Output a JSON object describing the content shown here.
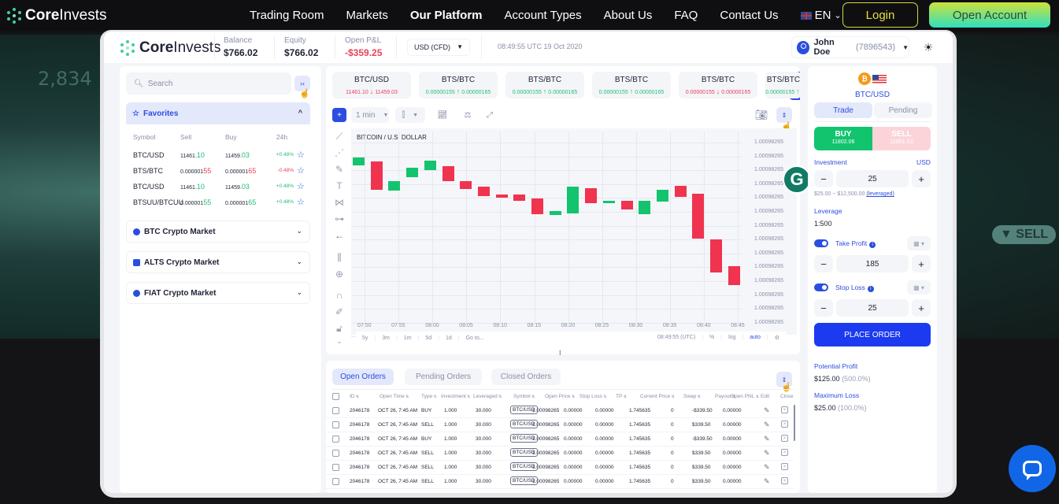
{
  "site": {
    "brand_bold": "Core",
    "brand_light": "Invests",
    "nav": [
      "Trading Room",
      "Markets",
      "Our Platform",
      "Account Types",
      "About Us",
      "FAQ",
      "Contact Us"
    ],
    "nav_active": "Our Platform",
    "language": "EN",
    "login_label": "Login",
    "open_account_label": "Open Account",
    "bg_price": "2,834",
    "bg_sell_badge": "SELL"
  },
  "header": {
    "brand_bold": "Core",
    "brand_light": "Invests",
    "balance_label": "Balance",
    "balance_value": "$766.02",
    "equity_label": "Equity",
    "equity_value": "$766.02",
    "pnl_label": "Open P&L",
    "pnl_value": "-$359.25",
    "currency_select": "USD (CFD)",
    "datetime": "08:49:55 UTC 19 Oct 2020",
    "user_name": "John Doe",
    "user_id": "(7896543)"
  },
  "sidebar": {
    "search_placeholder": "Search",
    "favorites_label": "Favorites",
    "columns": [
      "Symbol",
      "Sell",
      "Buy",
      "24h"
    ],
    "favorites": [
      {
        "symbol": "BTC/USD",
        "sell_main": "11461.",
        "sell_hi": "10",
        "buy_main": "11459.",
        "buy_hi": "03",
        "change": "+0.48%",
        "trend": "up"
      },
      {
        "symbol": "BTS/BTC",
        "sell_main": "0.000001",
        "sell_hi": "55",
        "buy_main": "0.000001",
        "buy_hi": "65",
        "change": "-0.48%",
        "trend": "down"
      },
      {
        "symbol": "BTC/USD",
        "sell_main": "11461.",
        "sell_hi": "10",
        "buy_main": "11459.",
        "buy_hi": "03",
        "change": "+0.48%",
        "trend": "up"
      },
      {
        "symbol": "BTSUU/BTCUU",
        "sell_main": "0.000001",
        "sell_hi": "55",
        "buy_main": "0.000001",
        "buy_hi": "65",
        "change": "+0.48%",
        "trend": "up"
      }
    ],
    "markets": [
      "BTC Crypto Market",
      "ALTS Crypto Market",
      "FIAT Crypto Market"
    ]
  },
  "tickers": [
    {
      "symbol": "BTC/USD",
      "sell": "11461.10",
      "buy": "11459.03",
      "trend": "down"
    },
    {
      "symbol": "BTS/BTC",
      "sell": "0.00000155",
      "buy": "0.00000165",
      "trend": "up"
    },
    {
      "symbol": "BTS/BTC",
      "sell": "0.00000155",
      "buy": "0.00000165",
      "trend": "up"
    },
    {
      "symbol": "BTS/BTC",
      "sell": "0.00000155",
      "buy": "0.00000165",
      "trend": "up"
    },
    {
      "symbol": "BTS/BTC",
      "sell": "0.00000155",
      "buy": "0.00000165",
      "trend": "down"
    },
    {
      "symbol": "BTS/BTC",
      "sell": "0.00000155",
      "buy": "",
      "trend": "up"
    }
  ],
  "chart_toolbar": {
    "interval": "1 min"
  },
  "chart_data": {
    "type": "candlestick",
    "title": "BITCOIN / U.S. DOLLAR",
    "x_ticks": [
      "07:50",
      "07:55",
      "08:00",
      "08:05",
      "08:10",
      "08:15",
      "08:20",
      "08:25",
      "08:30",
      "08:35",
      "08:40",
      "08:45"
    ],
    "y_ticks": [
      "1.00098265",
      "1.00098265",
      "1.00098265",
      "1.00098265",
      "1.00098265",
      "1.00098265",
      "1.00098265",
      "1.00098265",
      "1.00098265",
      "1.00098265",
      "1.00098265",
      "1.00098265",
      "1.00098265",
      "1.00098265",
      "1.00098265"
    ],
    "y_range_relative": [
      0,
      100
    ],
    "candles": [
      {
        "open": 85.5,
        "close": 90.5,
        "dir": "up"
      },
      {
        "open": 88,
        "close": 71,
        "dir": "down"
      },
      {
        "open": 70.5,
        "close": 76,
        "dir": "up"
      },
      {
        "open": 78.5,
        "close": 84,
        "dir": "up"
      },
      {
        "open": 83,
        "close": 88.5,
        "dir": "up"
      },
      {
        "open": 85,
        "close": 76,
        "dir": "down"
      },
      {
        "open": 76,
        "close": 71.5,
        "dir": "down"
      },
      {
        "open": 72.5,
        "close": 67,
        "dir": "down"
      },
      {
        "open": 68,
        "close": 66,
        "dir": "down"
      },
      {
        "open": 68,
        "close": 64,
        "dir": "down"
      },
      {
        "open": 65.5,
        "close": 56,
        "dir": "down"
      },
      {
        "open": 55.5,
        "close": 58,
        "dir": "up"
      },
      {
        "open": 56.5,
        "close": 72.5,
        "dir": "up"
      },
      {
        "open": 72,
        "close": 62.5,
        "dir": "down"
      },
      {
        "open": 62.5,
        "close": 64,
        "dir": "up"
      },
      {
        "open": 64,
        "close": 59,
        "dir": "down"
      },
      {
        "open": 56,
        "close": 64,
        "dir": "up"
      },
      {
        "open": 63.5,
        "close": 71,
        "dir": "up"
      },
      {
        "open": 73,
        "close": 66.5,
        "dir": "down"
      },
      {
        "open": 68.5,
        "close": 41,
        "dir": "down"
      },
      {
        "open": 40.5,
        "close": 20.5,
        "dir": "down"
      },
      {
        "open": 24.5,
        "close": 13,
        "dir": "down"
      }
    ],
    "range_buttons": [
      "5y",
      "3m",
      "1m",
      "5d",
      "1d",
      "Go to..."
    ],
    "clock": "08:49:55 (UTC)",
    "scale_options": [
      "%",
      "log",
      "auto"
    ]
  },
  "orders": {
    "tabs": [
      "Open Orders",
      "Pending Orders",
      "Closed Orders"
    ],
    "active_tab": "Open Orders",
    "columns": [
      "ID",
      "Open Time",
      "Type",
      "Investment",
      "Leveraged",
      "Symbol",
      "Open Price",
      "Stop Loss",
      "TP",
      "Current Price",
      "Swap",
      "Payout",
      "Open PNL",
      "Edit",
      "Close"
    ],
    "rows": [
      {
        "id": "2046178",
        "time": "OCT 26, 7:45 AM",
        "type": "BUY",
        "investment": "1.000",
        "leveraged": "30.000",
        "symbol": "BTC/USD",
        "open_price": "1.00098265",
        "stop_loss": "0.00000",
        "tp": "0.00000",
        "current": "1.745635",
        "swap": "0",
        "payout": "-$339.50",
        "pnl": "0.00000",
        "result": "loss"
      },
      {
        "id": "2046178",
        "time": "OCT 26, 7:45 AM",
        "type": "SELL",
        "investment": "1.000",
        "leveraged": "30.000",
        "symbol": "BTC/USD",
        "open_price": "1.00098265",
        "stop_loss": "0.00000",
        "tp": "0.00000",
        "current": "1.745635",
        "swap": "0",
        "payout": "$339.50",
        "pnl": "0.00000",
        "result": "gain"
      },
      {
        "id": "2046178",
        "time": "OCT 26, 7:45 AM",
        "type": "BUY",
        "investment": "1.000",
        "leveraged": "30.000",
        "symbol": "BTC/USD",
        "open_price": "1.00098265",
        "stop_loss": "0.00000",
        "tp": "0.00000",
        "current": "1.745635",
        "swap": "0",
        "payout": "-$339.50",
        "pnl": "0.00000",
        "result": "loss"
      },
      {
        "id": "2046178",
        "time": "OCT 26, 7:45 AM",
        "type": "SELL",
        "investment": "1.000",
        "leveraged": "30.000",
        "symbol": "BTC/USD",
        "open_price": "1.00098265",
        "stop_loss": "0.00000",
        "tp": "0.00000",
        "current": "1.745635",
        "swap": "0",
        "payout": "$339.50",
        "pnl": "0.00000",
        "result": "gain"
      },
      {
        "id": "2046178",
        "time": "OCT 26, 7:45 AM",
        "type": "SELL",
        "investment": "1.000",
        "leveraged": "30.000",
        "symbol": "BTC/USD",
        "open_price": "1.00098265",
        "stop_loss": "0.00000",
        "tp": "0.00000",
        "current": "1.745635",
        "swap": "0",
        "payout": "$339.50",
        "pnl": "0.00000",
        "result": "gain"
      },
      {
        "id": "2046178",
        "time": "OCT 26, 7:45 AM",
        "type": "SELL",
        "investment": "1.000",
        "leveraged": "30.000",
        "symbol": "BTC/USD",
        "open_price": "1.00098265",
        "stop_loss": "0.00000",
        "tp": "0.00000",
        "current": "1.745635",
        "swap": "0",
        "payout": "$339.50",
        "pnl": "0.00000",
        "result": "gain"
      }
    ]
  },
  "trade": {
    "symbol": "BTC/USD",
    "tabs": [
      "Trade",
      "Pending"
    ],
    "buy_label": "BUY",
    "buy_price": "11802.06",
    "sell_label": "SELL",
    "sell_price": "11801.53",
    "investment_label": "Investment",
    "investment_currency": "USD",
    "investment_value": "25",
    "investment_range": "$25.00 ~ $12,500.00",
    "leveraged_link": "(leveraged)",
    "leverage_label": "Leverage",
    "leverage_value": "1:500",
    "take_profit_label": "Take Profit",
    "take_profit_value": "185",
    "take_profit_enabled": true,
    "stop_loss_label": "Stop Loss",
    "stop_loss_value": "25",
    "stop_loss_enabled": true,
    "place_order_label": "PLACE ORDER",
    "potential_profit_label": "Potential Profit",
    "potential_profit_value": "$125.00",
    "potential_profit_pct": "(500.0%)",
    "max_loss_label": "Maximum Loss",
    "max_loss_value": "$25.00",
    "max_loss_pct": "(100.0%)"
  },
  "colors": {
    "accent": "#2b4ee0",
    "up": "#12c46e",
    "down": "#f0334f",
    "open_account_gradient_top": "#cfe13a",
    "open_account_gradient_bottom": "#2fe0c0",
    "login_border": "#d6d83a",
    "chat_button": "#1166e8"
  }
}
